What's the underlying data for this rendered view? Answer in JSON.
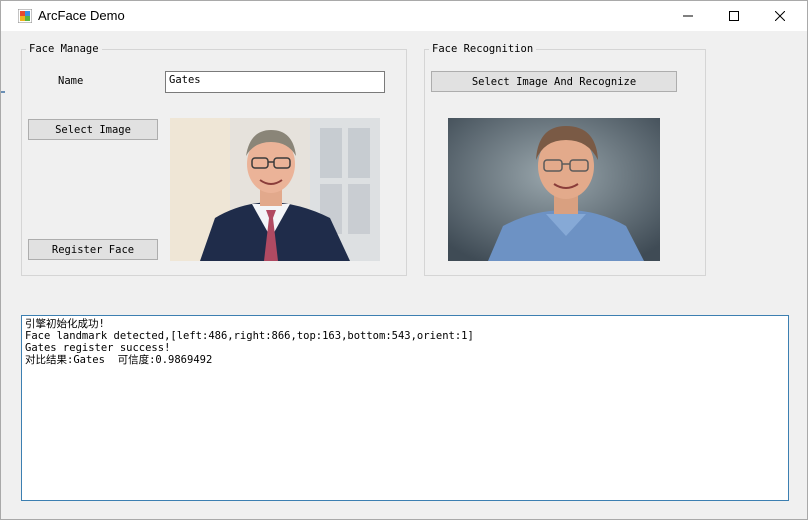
{
  "window": {
    "title": "ArcFace Demo"
  },
  "face_manage": {
    "legend": "Face Manage",
    "name_label": "Name",
    "name_value": "Gates",
    "select_image_label": "Select Image",
    "register_face_label": "Register Face"
  },
  "face_recognition": {
    "legend": "Face Recognition",
    "select_recognize_label": "Select Image And Recognize"
  },
  "log": {
    "lines": [
      "引擎初始化成功!",
      "Face landmark detected,[left:486,right:866,top:163,bottom:543,orient:1]",
      "Gates register success!",
      "对比结果:Gates  可信度:0.9869492"
    ]
  }
}
